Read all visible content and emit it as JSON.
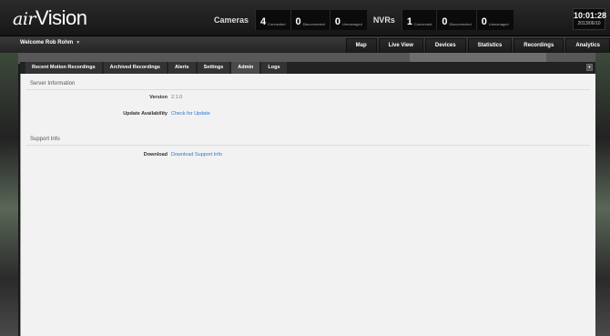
{
  "app": {
    "logo_prefix": "air",
    "logo_suffix": "Vision"
  },
  "stats": {
    "cameras": {
      "title": "Cameras",
      "cells": [
        {
          "num": "4",
          "label": "Connected"
        },
        {
          "num": "0",
          "label": "Disconnected"
        },
        {
          "num": "0",
          "label": "Unmanaged"
        }
      ]
    },
    "nvrs": {
      "title": "NVRs",
      "cells": [
        {
          "num": "1",
          "label": "Connected"
        },
        {
          "num": "0",
          "label": "Disconnected"
        },
        {
          "num": "0",
          "label": "Unmanaged"
        }
      ]
    }
  },
  "clock": {
    "time": "10:01:28",
    "date": "2013/06/10"
  },
  "welcome": "Welcome Rob Rohm",
  "main_nav": [
    "Map",
    "Live View",
    "Devices",
    "Statistics",
    "Recordings",
    "Analytics"
  ],
  "tabs": [
    "Recent Motion Recordings",
    "Archived Recordings",
    "Alerts",
    "Settings",
    "Admin",
    "Logs"
  ],
  "active_tab": "Admin",
  "server_info": {
    "heading": "Server Information",
    "version_label": "Version",
    "version_value": "2.1.0",
    "update_label": "Update Availability",
    "update_link": "Check for Update"
  },
  "support_info": {
    "heading": "Support Info",
    "download_label": "Download",
    "download_link": "Download Support Info"
  }
}
